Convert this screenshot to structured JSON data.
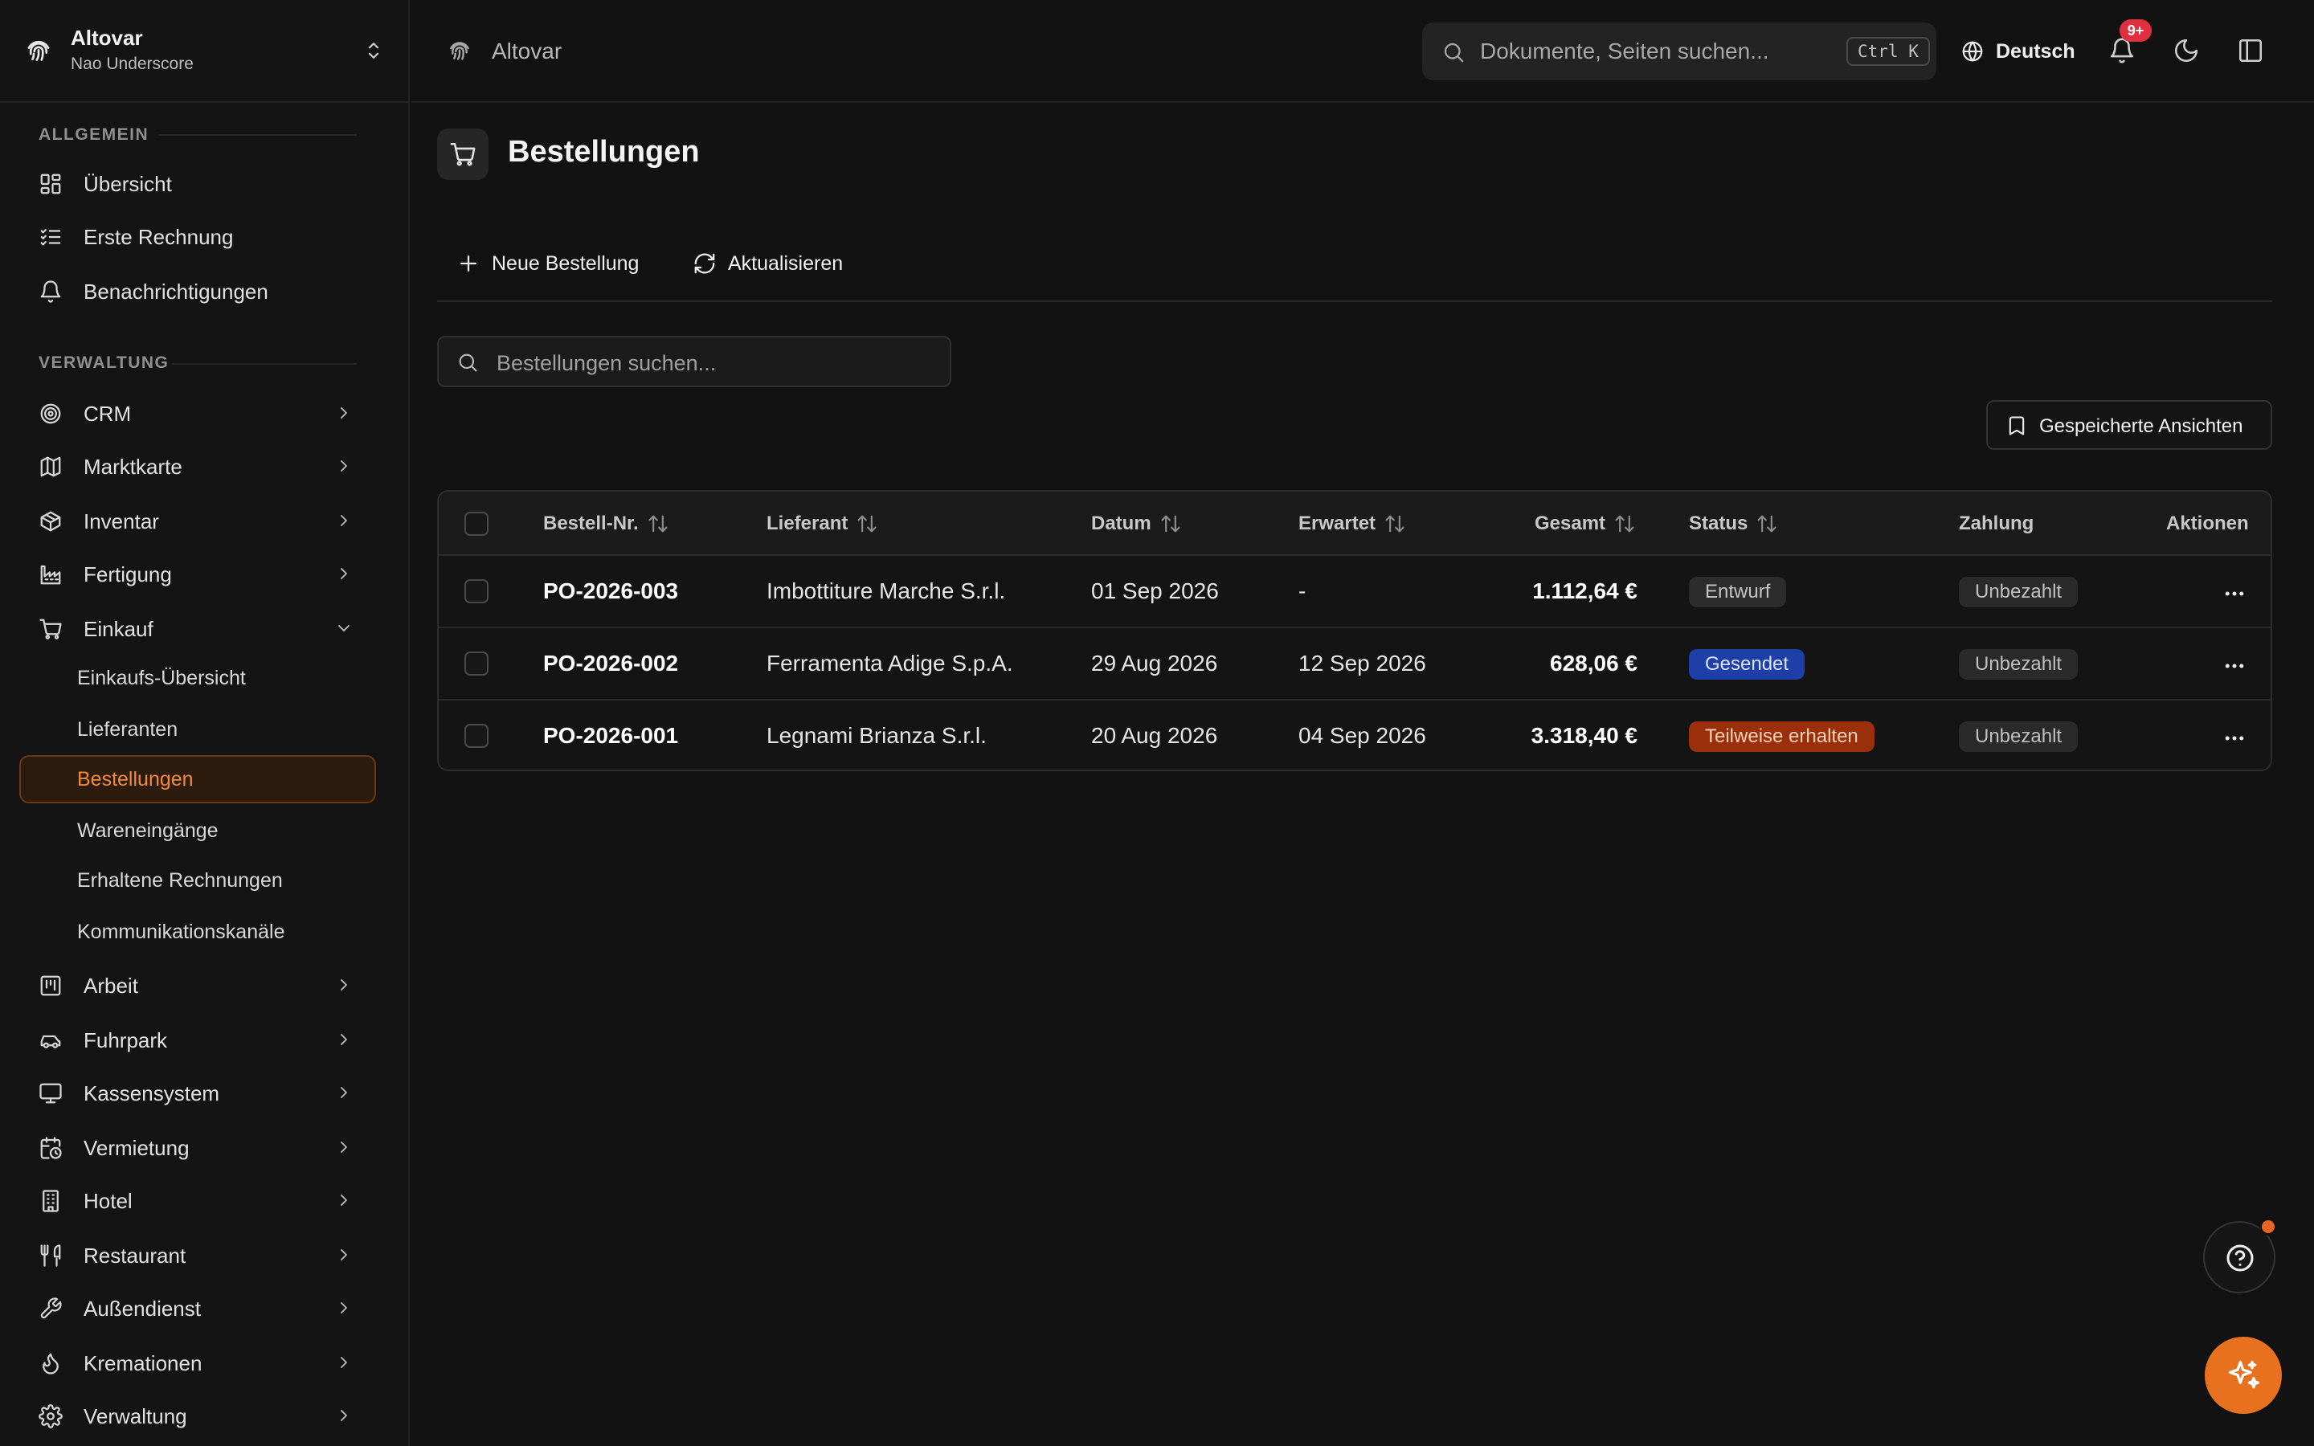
{
  "brand": {
    "name": "Altovar",
    "user": "Nao Underscore"
  },
  "sidebar": {
    "sections": [
      {
        "label": "ALLGEMEIN"
      },
      {
        "label": "VERWALTUNG"
      }
    ],
    "general_items": [
      {
        "label": "Übersicht",
        "icon": "dashboard-icon"
      },
      {
        "label": "Erste Rechnung",
        "icon": "checklist-icon"
      },
      {
        "label": "Benachrichtigungen",
        "icon": "bell-icon"
      }
    ],
    "admin_items": [
      {
        "label": "CRM",
        "icon": "target-icon"
      },
      {
        "label": "Marktkarte",
        "icon": "map-icon"
      },
      {
        "label": "Inventar",
        "icon": "box-icon"
      },
      {
        "label": "Fertigung",
        "icon": "factory-icon"
      },
      {
        "label": "Einkauf",
        "icon": "cart-icon"
      }
    ],
    "einkauf_sub": [
      {
        "label": "Einkaufs-Übersicht"
      },
      {
        "label": "Lieferanten"
      },
      {
        "label": "Bestellungen"
      },
      {
        "label": "Wareneingänge"
      },
      {
        "label": "Erhaltene Rechnungen"
      },
      {
        "label": "Kommunikationskanäle"
      }
    ],
    "more_items": [
      {
        "label": "Arbeit",
        "icon": "kanban-icon"
      },
      {
        "label": "Fuhrpark",
        "icon": "car-icon"
      },
      {
        "label": "Kassensystem",
        "icon": "monitor-icon"
      },
      {
        "label": "Vermietung",
        "icon": "calendar-clock-icon"
      },
      {
        "label": "Hotel",
        "icon": "building-icon"
      },
      {
        "label": "Restaurant",
        "icon": "utensils-icon"
      },
      {
        "label": "Außendienst",
        "icon": "wrench-icon"
      },
      {
        "label": "Kremationen",
        "icon": "flame-icon"
      },
      {
        "label": "Verwaltung",
        "icon": "settings-icon"
      }
    ],
    "active": "Bestellungen"
  },
  "topbar": {
    "breadcrumb": "Altovar",
    "search_placeholder": "Dokumente, Seiten suchen...",
    "shortcut": "Ctrl K",
    "language": "Deutsch",
    "notification_count": "9+"
  },
  "page": {
    "title": "Bestellungen",
    "new_button": "Neue Bestellung",
    "refresh_button": "Aktualisieren",
    "search_placeholder": "Bestellungen suchen...",
    "saved_views": "Gespeicherte Ansichten"
  },
  "table": {
    "headers": {
      "number": "Bestell-Nr.",
      "supplier": "Lieferant",
      "date": "Datum",
      "expected": "Erwartet",
      "total": "Gesamt",
      "status": "Status",
      "payment": "Zahlung",
      "actions": "Aktionen"
    },
    "rows": [
      {
        "number": "PO-2026-003",
        "supplier": "Imbottiture Marche S.r.l.",
        "date": "01 Sep 2026",
        "expected": "-",
        "total": "1.112,64 €",
        "status": "Entwurf",
        "payment": "Unbezahlt"
      },
      {
        "number": "PO-2026-002",
        "supplier": "Ferramenta Adige S.p.A.",
        "date": "29 Aug 2026",
        "expected": "12 Sep 2026",
        "total": "628,06 €",
        "status": "Gesendet",
        "payment": "Unbezahlt"
      },
      {
        "number": "PO-2026-001",
        "supplier": "Legnami Brianza S.r.l.",
        "date": "20 Aug 2026",
        "expected": "04 Sep 2026",
        "total": "3.318,40 €",
        "status": "Teilweise erhalten",
        "payment": "Unbezahlt"
      }
    ]
  },
  "colors": {
    "accent": "#e8711f",
    "status_draft_bg": "#2c2c2c",
    "status_sent_bg": "#1f3fa8",
    "status_partial_bg": "#9a2f0b",
    "badge": "#e0303f"
  }
}
